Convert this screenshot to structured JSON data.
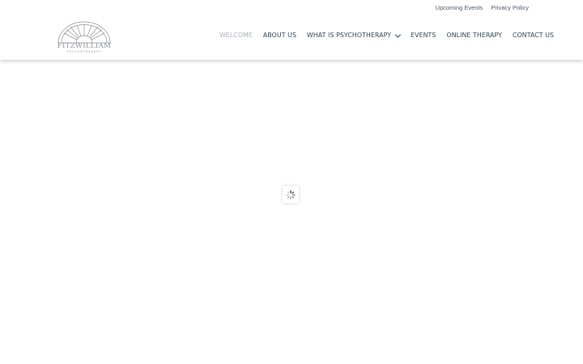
{
  "top_links": [
    {
      "label": "Upcoming Events"
    },
    {
      "label": "Privacy Policy"
    }
  ],
  "logo": {
    "word": "FITZWILLIAM",
    "sub": "PSYCHOTHERAPY",
    "icon": "fanlight-window-logo"
  },
  "nav": [
    {
      "label": "WELCOME",
      "active": true
    },
    {
      "label": "ABOUT US"
    },
    {
      "label": "WHAT IS PSYCHOTHERAPY",
      "has_dropdown": true
    },
    {
      "label": "EVENTS"
    },
    {
      "label": "ONLINE THERAPY"
    },
    {
      "label": "CONTACT US"
    }
  ],
  "loader": {
    "icon": "spinner-icon"
  },
  "colors": {
    "nav_text": "#2f4454",
    "nav_active": "#a9b1b8",
    "top_link_text": "#4a5a6a",
    "logo": "#8a8f97"
  }
}
